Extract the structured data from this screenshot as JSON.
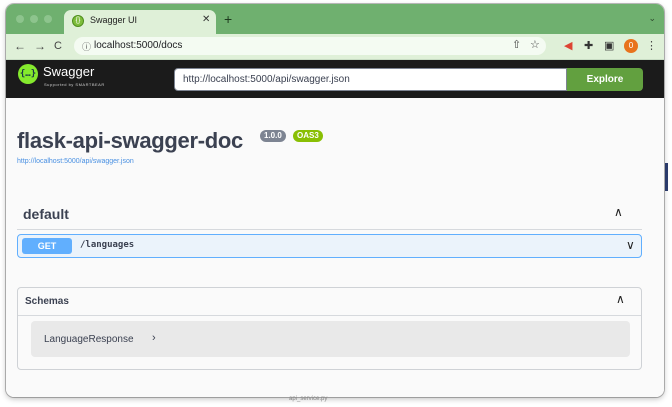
{
  "browser": {
    "tab": {
      "title": "Swagger UI",
      "close": "✕",
      "favicon": "swagger-favicon-icon"
    },
    "new_tab": "+",
    "tab_menu": "⌄",
    "nav": {
      "back": "←",
      "forward": "→",
      "reload": "C"
    },
    "url": "localhost:5000/docs",
    "profile_initial": "0"
  },
  "swagger": {
    "logo_text": "Swagger",
    "logo_glyph": "{…}",
    "logo_sub": "Supported by SMARTBEAR",
    "spec_url": "http://localhost:5000/api/swagger.json",
    "explore_label": "Explore",
    "colors": {
      "topbar": "#1b1b1b",
      "explore": "#62a03f",
      "get": "#61affe"
    }
  },
  "info": {
    "title": "flask-api-swagger-doc",
    "version": "1.0.0",
    "oas": "OAS3",
    "spec_link": "http://localhost:5000/api/swagger.json"
  },
  "tag": {
    "name": "default",
    "operations": [
      {
        "method": "GET",
        "path": "/languages"
      }
    ]
  },
  "schemas": {
    "title": "Schemas",
    "models": [
      {
        "name": "LanguageResponse"
      }
    ]
  },
  "icons": {
    "chevron_up": "∧",
    "chevron_down": "∨",
    "expand": "›"
  },
  "below_window_text": "api_service.py"
}
